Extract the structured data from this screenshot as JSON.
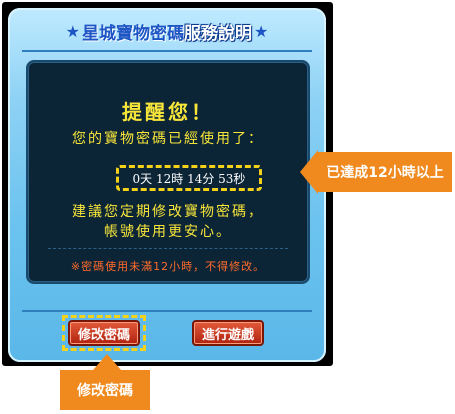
{
  "dialog": {
    "title_part1": "星城寶物密碼",
    "title_part2": "服務說明",
    "star_left": "★",
    "star_right": "★",
    "heading": "提醒您！",
    "message_line1": "您的寶物密碼已經使用了：",
    "elapsed_time": "0天 12時 14分 53秒",
    "message_line2": "建議您定期修改寶物密碼，",
    "message_line3": "帳號使用更安心。",
    "note": "※密碼使用未滿12小時，不得修改。",
    "modify_button": "修改密碼",
    "play_button": "進行遊戲"
  },
  "callouts": {
    "right": "已達成12小時以上",
    "bottom": "修改密碼"
  },
  "colors": {
    "frame_blue": "#6cc3ef",
    "panel_bg": "#0c2536",
    "text_yellow": "#f7e53a",
    "note_orange": "#ff6a2a",
    "button_red": "#b0220f",
    "callout_orange": "#f08a1e",
    "highlight_yellow": "#f5d21a"
  }
}
